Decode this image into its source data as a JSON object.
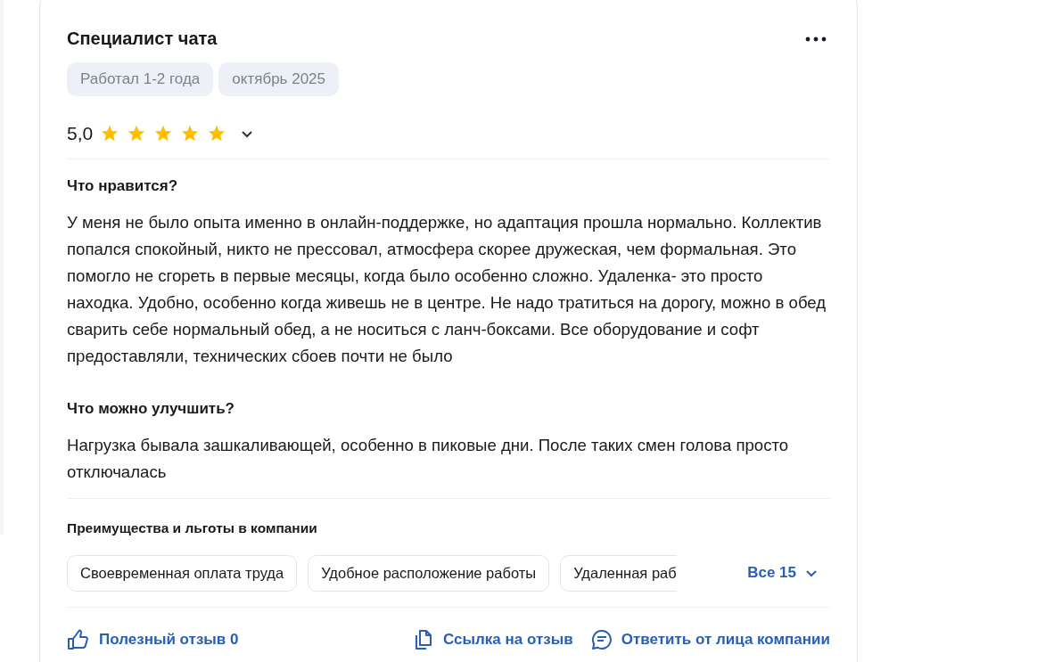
{
  "review": {
    "title": "Специалист чата",
    "tags": [
      "Работал 1-2 года",
      "октябрь 2025"
    ],
    "rating": "5,0",
    "stars": 5,
    "sections": [
      {
        "heading": "Что нравится?",
        "text": "У меня не было опыта именно в онлайн-поддержке, но адаптация прошла нормально. Коллектив попался спокойный, никто не прессовал, атмосфера скорее дружеская, чем формальная. Это помогло не сгореть в первые месяцы, когда было особенно сложно. Удаленка- это просто находка. Удобно, особенно когда живешь не в центре. Не надо тратиться на дорогу, можно в обед сварить себе нормальный обед, а не носиться с ланч-боксами. Все оборудование и софт предоставляли, технических сбоев почти не было"
      },
      {
        "heading": "Что можно улучшить?",
        "text": "Нагрузка бывала зашкаливающей, особенно в пиковые дни. После таких смен голова просто отключалась"
      }
    ],
    "benefits": {
      "heading": "Преимущества и льготы в компании",
      "items": [
        "Своевременная оплата труда",
        "Удобное расположение работы",
        "Удаленная раб"
      ],
      "more": "Все 15"
    },
    "actions": [
      {
        "kind": "like",
        "label": "Полезный отзыв 0"
      },
      {
        "kind": "link",
        "label": "Ссылка на отзыв"
      },
      {
        "kind": "reply",
        "label": "Ответить от лица компании"
      }
    ]
  }
}
